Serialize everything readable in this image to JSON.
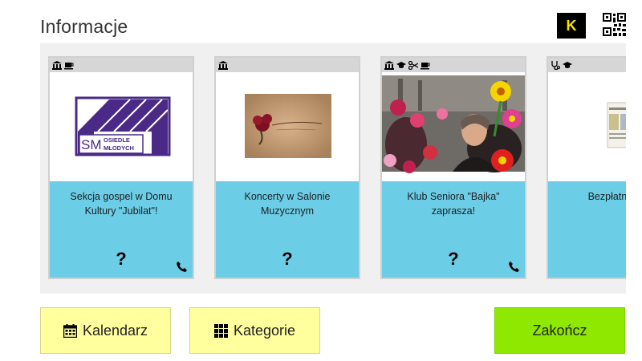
{
  "header": {
    "title": "Informacje",
    "k_label": "K"
  },
  "cards": [
    {
      "text": "Sekcja gospel w Domu Kultury \"Jubilat\"!",
      "help": "?",
      "logo_text_1": "SM",
      "logo_text_2": "OSIEDLE",
      "logo_text_3": "MŁODYCH"
    },
    {
      "text": "Koncerty w Salonie Muzycznym",
      "help": "?"
    },
    {
      "text": "Klub Seniora \"Bajka\" zaprasza!",
      "help": "?"
    },
    {
      "text": "Bezpłatne psycholo",
      "help": "?"
    }
  ],
  "buttons": {
    "calendar": "Kalendarz",
    "categories": "Kategorie",
    "finish": "Zakończ"
  },
  "colors": {
    "card_info": "#6bcde6",
    "button_yellow": "#ffff9d",
    "button_green": "#8ee800",
    "k_badge_text": "#f5e200"
  }
}
